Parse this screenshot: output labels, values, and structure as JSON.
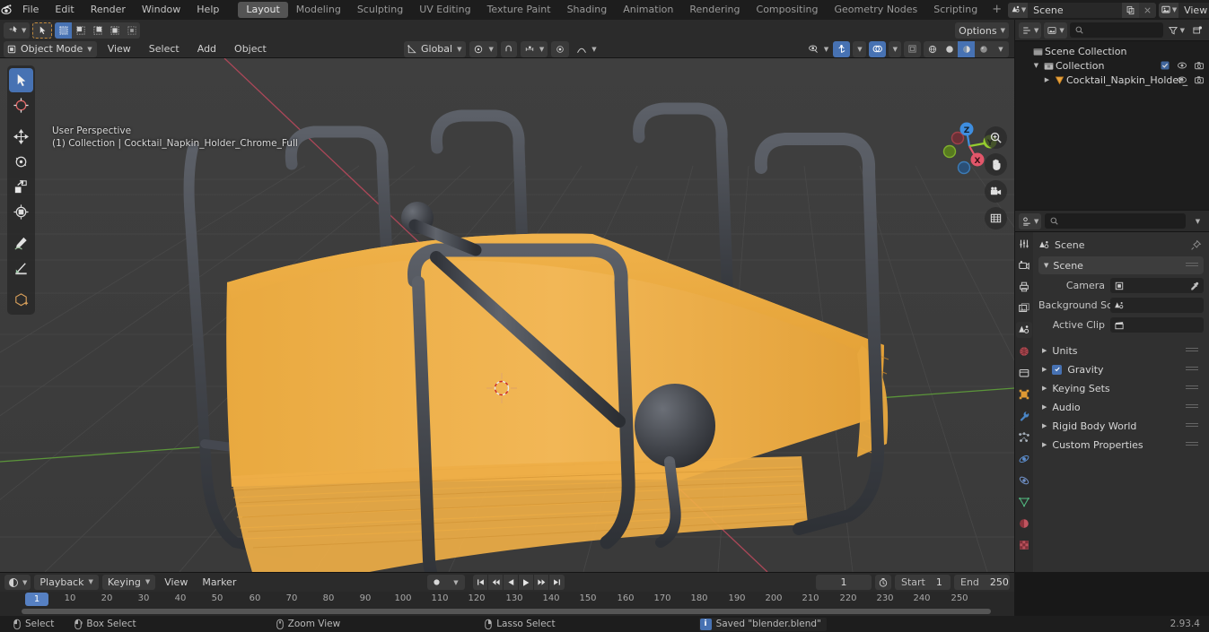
{
  "app": {
    "name": "Blender",
    "version": "2.93.4",
    "logo_icon": "blender-logo-icon"
  },
  "topbar": {
    "menus": [
      "File",
      "Edit",
      "Render",
      "Window",
      "Help"
    ],
    "workspaces": [
      {
        "label": "Layout",
        "active": true
      },
      {
        "label": "Modeling",
        "active": false
      },
      {
        "label": "Sculpting",
        "active": false
      },
      {
        "label": "UV Editing",
        "active": false
      },
      {
        "label": "Texture Paint",
        "active": false
      },
      {
        "label": "Shading",
        "active": false
      },
      {
        "label": "Animation",
        "active": false
      },
      {
        "label": "Rendering",
        "active": false
      },
      {
        "label": "Compositing",
        "active": false
      },
      {
        "label": "Geometry Nodes",
        "active": false
      },
      {
        "label": "Scripting",
        "active": false
      }
    ],
    "add_workspace_label": "+",
    "scene_name": "Scene",
    "view_layer_name": "View Layer"
  },
  "viewport_header": {
    "editor_type_icon": "editor-type-3dview-icon",
    "mode": "Object Mode",
    "menus": [
      "View",
      "Select",
      "Add",
      "Object"
    ],
    "transform_orientation": "Global",
    "snap_icon": "magnet-icon",
    "proportional_icon": "proportional-editing-icon",
    "options_label": "Options",
    "select_modes": [
      "tweak",
      "box-select",
      "circle-select",
      "lasso-select"
    ],
    "shading_modes": [
      "wireframe",
      "solid",
      "material-preview",
      "rendered"
    ],
    "active_shading": "material-preview"
  },
  "viewport": {
    "perspective_label": "User Perspective",
    "context_label": "(1) Collection | Cocktail_Napkin_Holder_Chrome_Full",
    "background_color": "#3c3c3c",
    "grid_color": "#4a4a4a",
    "axis_x_color": "#cc4455",
    "axis_y_color": "#6ead3f",
    "object_metal_color": "#4a4d52",
    "object_napkin_color": "#e8a93f",
    "tools": [
      {
        "name": "tweak",
        "label": "Tweak",
        "active": true
      },
      {
        "name": "cursor",
        "label": "Cursor",
        "active": false
      },
      {
        "name": "move",
        "label": "Move",
        "active": false
      },
      {
        "name": "rotate",
        "label": "Rotate",
        "active": false
      },
      {
        "name": "scale",
        "label": "Scale",
        "active": false
      },
      {
        "name": "transform",
        "label": "Transform",
        "active": false
      },
      {
        "name": "annotate",
        "label": "Annotate",
        "active": false
      },
      {
        "name": "measure",
        "label": "Measure",
        "active": false
      },
      {
        "name": "add-cube",
        "label": "Add Cube",
        "active": false
      }
    ],
    "gizmo_axes": [
      {
        "label": "X",
        "color": "#e2566a"
      },
      {
        "label": "Y",
        "color": "#95cd2f"
      },
      {
        "label": "Z",
        "color": "#3e8ee0"
      }
    ],
    "nav_buttons": [
      "zoom-icon",
      "pan-hand-icon",
      "camera-view-icon",
      "ortho-persp-icon"
    ]
  },
  "outliner": {
    "display_mode_icon": "outliner-display-mode-icon",
    "filter_icon": "filter-funnel-icon",
    "new_collection_icon": "new-collection-icon",
    "search_placeholder": "",
    "rows": [
      {
        "label": "Scene Collection",
        "icon": "scene-collection-icon",
        "indent": 0,
        "disclosure": "",
        "checkbox": false,
        "eye": false,
        "camera": false
      },
      {
        "label": "Collection",
        "icon": "collection-icon",
        "indent": 1,
        "disclosure": "down",
        "checkbox": true,
        "eye": true,
        "camera": true
      },
      {
        "label": "Cocktail_Napkin_Holder_",
        "icon": "mesh-object-icon",
        "indent": 2,
        "disclosure": "right",
        "checkbox": false,
        "eye": true,
        "camera": true
      }
    ]
  },
  "properties": {
    "search_placeholder": "",
    "tabs": [
      {
        "name": "tool",
        "icon": "tool-icon",
        "active": false
      },
      {
        "name": "render",
        "icon": "render-camera-icon",
        "active": false
      },
      {
        "name": "output",
        "icon": "output-printer-icon",
        "active": false
      },
      {
        "name": "view-layer",
        "icon": "view-layer-images-icon",
        "active": false
      },
      {
        "name": "scene",
        "icon": "scene-cone-icon",
        "active": true
      },
      {
        "name": "world",
        "icon": "world-globe-icon",
        "active": false
      },
      {
        "name": "collection",
        "icon": "collection-box-icon",
        "active": false
      },
      {
        "name": "object",
        "icon": "object-square-icon",
        "active": false
      },
      {
        "name": "modifiers",
        "icon": "wrench-icon",
        "active": false
      },
      {
        "name": "particles",
        "icon": "particles-icon",
        "active": false
      },
      {
        "name": "physics",
        "icon": "physics-orbit-icon",
        "active": false
      },
      {
        "name": "constraints",
        "icon": "constraints-icon",
        "active": false
      },
      {
        "name": "data",
        "icon": "object-data-triangle-icon",
        "active": false
      },
      {
        "name": "material",
        "icon": "material-sphere-icon",
        "active": false
      },
      {
        "name": "texture",
        "icon": "texture-checker-icon",
        "active": false
      }
    ],
    "breadcrumb": "Scene",
    "breadcrumb_icon": "scene-cone-icon",
    "pin_icon": "pin-icon",
    "panel_title": "Scene",
    "fields": [
      {
        "label": "Camera",
        "value": "",
        "icon": "camera-data-icon",
        "eyedropper": true
      },
      {
        "label": "Background Sce...",
        "value": "",
        "icon": "scene-cone-icon",
        "eyedropper": false
      },
      {
        "label": "Active Clip",
        "value": "",
        "icon": "movie-clip-icon",
        "eyedropper": false
      }
    ],
    "sub_panels": [
      {
        "label": "Units",
        "checkbox": false,
        "grip": true
      },
      {
        "label": "Gravity",
        "checkbox": true,
        "grip": true
      },
      {
        "label": "Keying Sets",
        "checkbox": false,
        "grip": true
      },
      {
        "label": "Audio",
        "checkbox": false,
        "grip": true
      },
      {
        "label": "Rigid Body World",
        "checkbox": false,
        "grip": true
      },
      {
        "label": "Custom Properties",
        "checkbox": false,
        "grip": true
      }
    ]
  },
  "timeline": {
    "editor_icon": "timeline-editor-icon",
    "menus": [
      "Playback",
      "Keying",
      "View",
      "Marker"
    ],
    "record_icon": "record-icon",
    "transport": [
      "jump-start-icon",
      "prev-keyframe-icon",
      "play-reverse-icon",
      "play-icon",
      "next-keyframe-icon",
      "jump-end-icon"
    ],
    "current_frame": "1",
    "start_label": "Start",
    "start_value": "1",
    "end_label": "End",
    "end_value": "250",
    "playhead_frame": "1",
    "ticks": [
      "10",
      "20",
      "30",
      "40",
      "50",
      "60",
      "70",
      "80",
      "90",
      "100",
      "110",
      "120",
      "130",
      "140",
      "150",
      "160",
      "170",
      "180",
      "190",
      "200",
      "210",
      "220",
      "230",
      "240",
      "250"
    ]
  },
  "statusbar": {
    "hints": [
      {
        "label": "Select",
        "icon": "mouse-left-icon"
      },
      {
        "label": "Box Select",
        "icon": "mouse-left-drag-icon"
      },
      {
        "label": "Zoom View",
        "icon": "mouse-middle-icon"
      },
      {
        "label": "Lasso Select",
        "icon": "mouse-right-icon"
      }
    ],
    "message": "Saved \"blender.blend\"",
    "message_icon": "info-icon",
    "version": "2.93.4"
  }
}
